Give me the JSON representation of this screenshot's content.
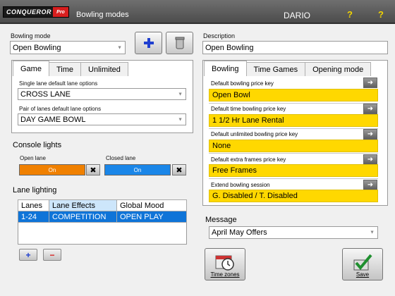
{
  "header": {
    "logo_text": "CONQUEROR",
    "logo_badge": "Pro",
    "title": "Bowling modes",
    "user": "DARIO",
    "help_label": "?",
    "help2_label": "?"
  },
  "bowling_mode": {
    "label": "Bowling mode",
    "value": "Open Bowling",
    "add_icon": "add-icon",
    "delete_icon": "trash-icon"
  },
  "description": {
    "label": "Description",
    "value": "Open Bowling"
  },
  "left_tabs": [
    "Game",
    "Time",
    "Unlimited"
  ],
  "lane_options": {
    "single_label": "Single lane default lane options",
    "single_value": "CROSS LANE",
    "pair_label": "Pair of lanes default lane options",
    "pair_value": "DAY GAME BOWL"
  },
  "console_lights": {
    "title": "Console lights",
    "open_label": "Open lane",
    "open_value": "On",
    "open_color": "#f08000",
    "closed_label": "Closed lane",
    "closed_value": "On",
    "closed_color": "#1a86e8",
    "clear_icon": "clear-icon"
  },
  "lane_lighting": {
    "title": "Lane lighting",
    "columns": [
      "Lanes",
      "Lane Effects",
      "Global Mood"
    ],
    "rows": [
      [
        "1-24",
        "COMPETITION",
        "OPEN PLAY"
      ]
    ],
    "add_label": "+",
    "remove_label": "−"
  },
  "right_tabs": [
    "Bowling",
    "Time Games",
    "Opening mode"
  ],
  "price_keys": [
    {
      "label": "Default bowling price key",
      "value": "Open Bowl"
    },
    {
      "label": "Default time bowling price key",
      "value": "1 1/2 Hr Lane Rental"
    },
    {
      "label": "Default unlimited bowling price key",
      "value": "None"
    },
    {
      "label": "Default extra frames price key",
      "value": "Free Frames"
    },
    {
      "label": "Extend bowling session",
      "value": "G. Disabled / T. Disabled"
    }
  ],
  "accent_color": "#ffd800",
  "message": {
    "title": "Message",
    "value": "April May Offers"
  },
  "footer": {
    "time_zones_label": "Time zones",
    "save_label": "Save"
  }
}
